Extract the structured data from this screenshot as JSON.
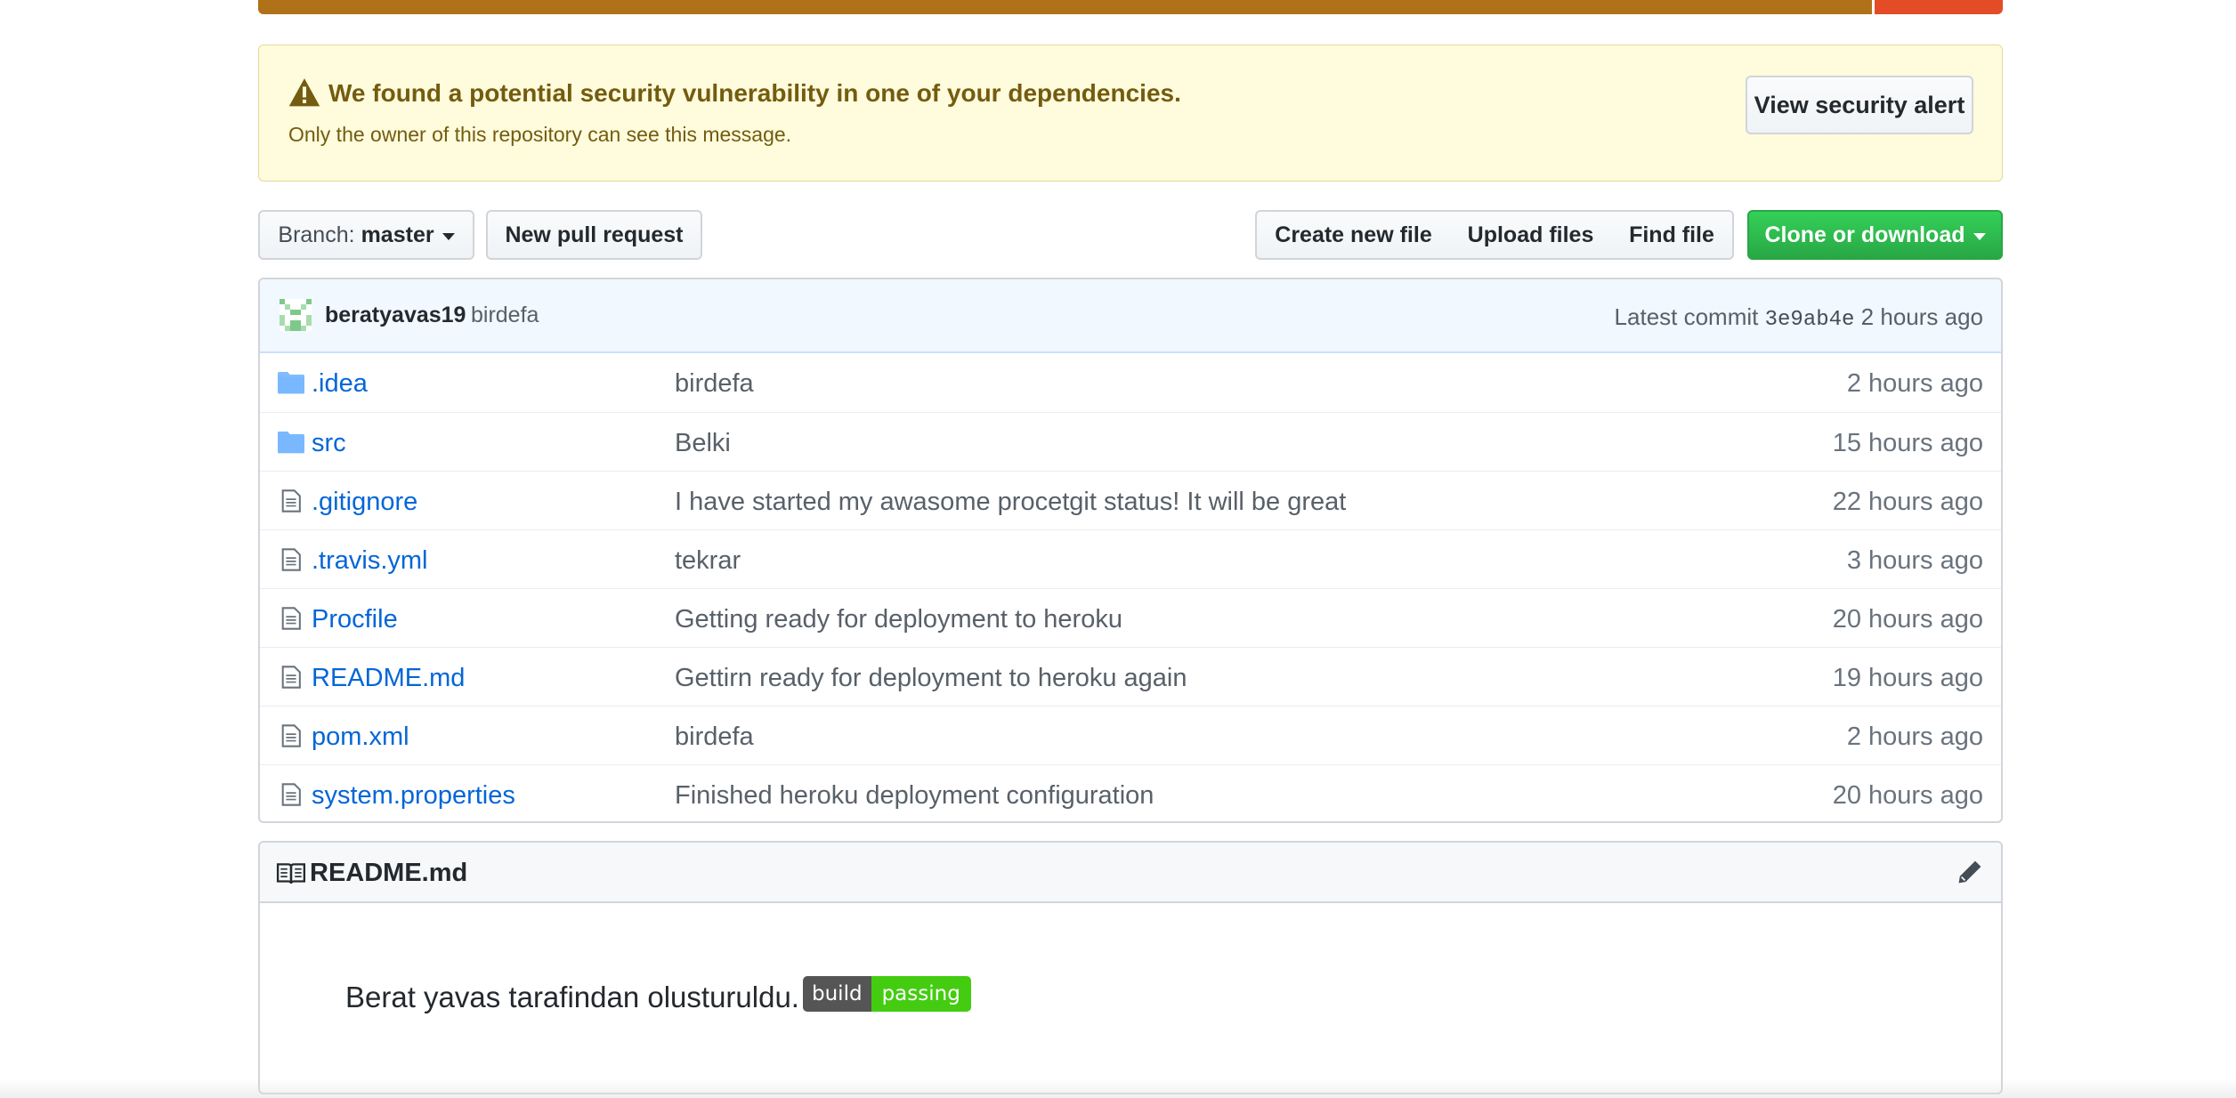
{
  "colors": {
    "language_primary": "#b07219",
    "language_secondary": "#e34c26",
    "link": "#0366d6",
    "clone_button": "#28a745"
  },
  "alert": {
    "icon": "alert-triangle-icon",
    "title": "We found a potential security vulnerability in one of your dependencies.",
    "subtitle": "Only the owner of this repository can see this message.",
    "button": "View security alert"
  },
  "toolbar": {
    "branch_label": "Branch:",
    "branch_value": "master",
    "new_pull_request": "New pull request",
    "create_new_file": "Create new file",
    "upload_files": "Upload files",
    "find_file": "Find file",
    "clone_or_download": "Clone or download"
  },
  "commit": {
    "author": "beratyavas19",
    "message": "birdefa",
    "latest_label": "Latest commit",
    "sha": "3e9ab4e",
    "age": "2 hours ago"
  },
  "files": [
    {
      "type": "folder",
      "icon": "folder-icon",
      "name": ".idea",
      "message": "birdefa",
      "age": "2 hours ago"
    },
    {
      "type": "folder",
      "icon": "folder-icon",
      "name": "src",
      "message": "Belki",
      "age": "15 hours ago"
    },
    {
      "type": "file",
      "icon": "file-icon",
      "name": ".gitignore",
      "message": "I have started my awasome procetgit status! It will be great",
      "age": "22 hours ago"
    },
    {
      "type": "file",
      "icon": "file-icon",
      "name": ".travis.yml",
      "message": "tekrar",
      "age": "3 hours ago"
    },
    {
      "type": "file",
      "icon": "file-icon",
      "name": "Procfile",
      "message": "Getting ready for deployment to heroku",
      "age": "20 hours ago"
    },
    {
      "type": "file",
      "icon": "file-icon",
      "name": "README.md",
      "message": "Gettirn ready for deployment to heroku again",
      "age": "19 hours ago"
    },
    {
      "type": "file",
      "icon": "file-icon",
      "name": "pom.xml",
      "message": "birdefa",
      "age": "2 hours ago"
    },
    {
      "type": "file",
      "icon": "file-icon",
      "name": "system.properties",
      "message": "Finished heroku deployment configuration",
      "age": "20 hours ago"
    }
  ],
  "readme": {
    "title": "README.md",
    "text": "Berat yavas tarafindan olusturuldu.",
    "badge_left": "build",
    "badge_right": "passing"
  }
}
